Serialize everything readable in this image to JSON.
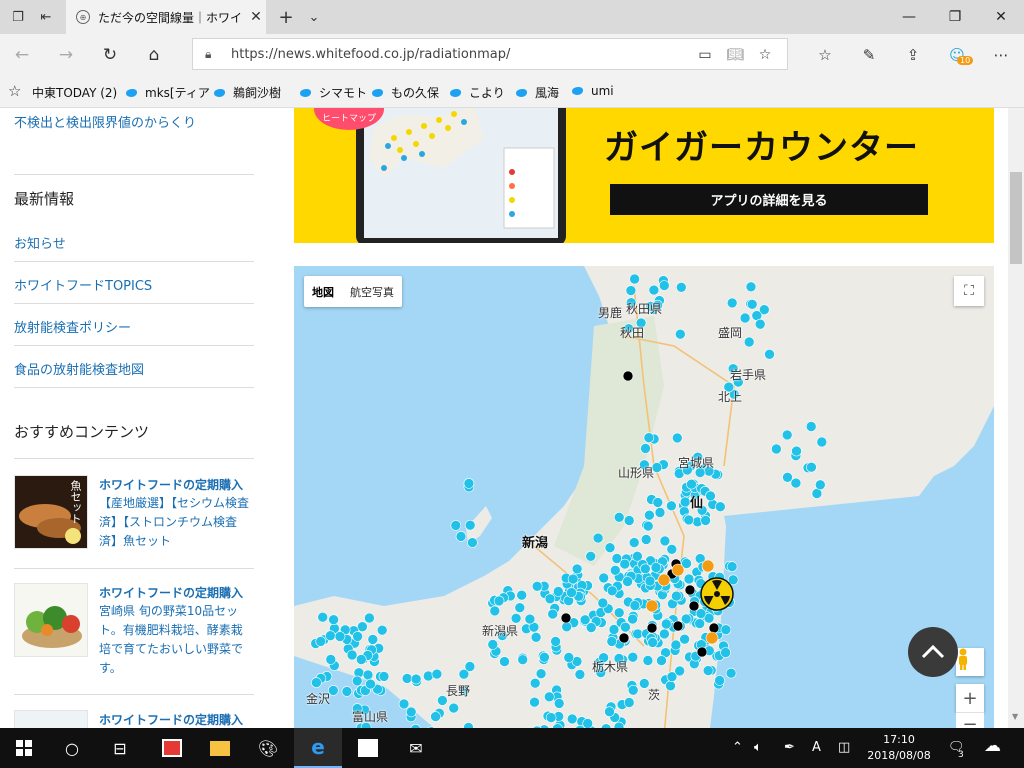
{
  "browser": {
    "tab_title": "ただ今の空間線量｜ホワイ",
    "url": "https://news.whitefood.co.jp/radiationmap/",
    "notif_badge": "10"
  },
  "favorites": [
    {
      "label": "中東TODAY (2)",
      "icon": "none"
    },
    {
      "label": "mks[ティア",
      "icon": "twitter"
    },
    {
      "label": "鵜飼沙樹",
      "icon": "twitter"
    },
    {
      "label": "シマモト",
      "icon": "twitter"
    },
    {
      "label": "もの久保",
      "icon": "twitter"
    },
    {
      "label": "こより",
      "icon": "twitter"
    },
    {
      "label": "風海",
      "icon": "twitter"
    },
    {
      "label": "umi",
      "icon": "twitter"
    }
  ],
  "sidebar": {
    "top_link": "不検出と検出限界値のからくり",
    "latest_heading": "最新情報",
    "latest_links": [
      "お知らせ",
      "ホワイトフードTOPICS",
      "放射能検査ポリシー",
      "食品の放射能検査地図"
    ],
    "recommend_heading": "おすすめコンテンツ",
    "recommend": [
      {
        "title": "ホワイトフードの定期購入",
        "desc": "【産地厳選】【セシウム検査済】【ストロンチウム検査済】魚セット",
        "thumb_text": "魚セット"
      },
      {
        "title": "ホワイトフードの定期購入",
        "desc": "宮崎県 旬の野菜10品セット。有機肥料栽培、酵素栽培で育てたおいしい野菜です。"
      },
      {
        "title": "ホワイトフードの定期購入",
        "desc": ""
      }
    ]
  },
  "banner": {
    "title": "ガイガーカウンター",
    "button": "アプリの詳細を見る",
    "sticker": "ヒートマップ"
  },
  "map": {
    "type_map": "地図",
    "type_satellite": "航空写真",
    "labels": {
      "akita": "秋田県",
      "oga": "男鹿",
      "akita_city": "秋田",
      "morioka": "盛岡",
      "iwate": "岩手県",
      "kitakami": "北上",
      "yamagata": "山形県",
      "miyagi": "宮城県",
      "sendai": "仙",
      "niigata_city": "新潟",
      "niigata": "新潟県",
      "tochigi": "栃木県",
      "nagano": "長野",
      "toyama": "富山県",
      "kanazawa": "金沢",
      "ibaraki": "茨"
    },
    "colors": {
      "sea": "#a3d7f5",
      "land": "#ecebe6",
      "dot": "#22c1e8",
      "dot_black": "#000000",
      "dot_orange": "#f39c12"
    }
  },
  "taskbar": {
    "time": "17:10",
    "date": "2018/08/08",
    "notif_count": "3",
    "ime": "A"
  }
}
